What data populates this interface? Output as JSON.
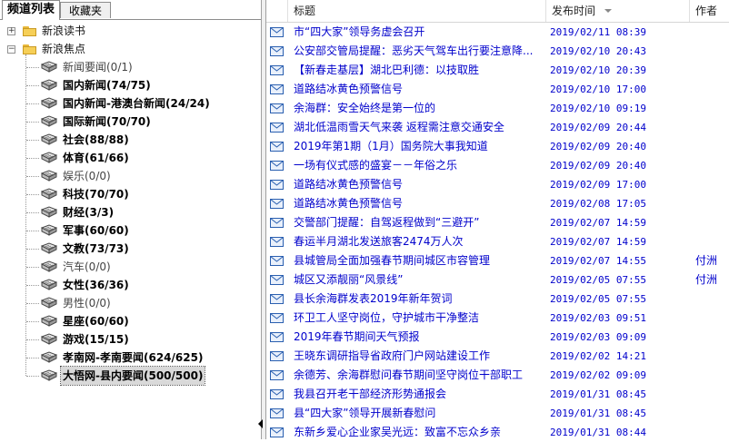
{
  "left_panel": {
    "tabs": [
      {
        "label": "频道列表",
        "active": true
      },
      {
        "label": "收藏夹",
        "active": false
      }
    ],
    "tree": [
      {
        "label": "新浪读书",
        "level": 0,
        "type": "folder",
        "expander": "+"
      },
      {
        "label": "新浪焦点",
        "level": 0,
        "type": "folder",
        "expander": "−"
      },
      {
        "label": "新闻要闻(0/1)",
        "level": 1,
        "type": "channel",
        "bold": false
      },
      {
        "label": "国内新闻(74/75)",
        "level": 1,
        "type": "channel",
        "bold": true
      },
      {
        "label": "国内新闻-港澳台新闻(24/24)",
        "level": 1,
        "type": "channel",
        "bold": true
      },
      {
        "label": "国际新闻(70/70)",
        "level": 1,
        "type": "channel",
        "bold": true
      },
      {
        "label": "社会(88/88)",
        "level": 1,
        "type": "channel",
        "bold": true
      },
      {
        "label": "体育(61/66)",
        "level": 1,
        "type": "channel",
        "bold": true
      },
      {
        "label": "娱乐(0/0)",
        "level": 1,
        "type": "channel",
        "bold": false
      },
      {
        "label": "科技(70/70)",
        "level": 1,
        "type": "channel",
        "bold": true
      },
      {
        "label": "财经(3/3)",
        "level": 1,
        "type": "channel",
        "bold": true
      },
      {
        "label": "军事(60/60)",
        "level": 1,
        "type": "channel",
        "bold": true
      },
      {
        "label": "文教(73/73)",
        "level": 1,
        "type": "channel",
        "bold": true
      },
      {
        "label": "汽车(0/0)",
        "level": 1,
        "type": "channel",
        "bold": false
      },
      {
        "label": "女性(36/36)",
        "level": 1,
        "type": "channel",
        "bold": true
      },
      {
        "label": "男性(0/0)",
        "level": 1,
        "type": "channel",
        "bold": false
      },
      {
        "label": "星座(60/60)",
        "level": 1,
        "type": "channel",
        "bold": true
      },
      {
        "label": "游戏(15/15)",
        "level": 1,
        "type": "channel",
        "bold": true
      },
      {
        "label": "孝南网-孝南要闻(624/625)",
        "level": 1,
        "type": "channel",
        "bold": true
      },
      {
        "label": "大悟网-县内要闻(500/500)",
        "level": 1,
        "type": "channel",
        "bold": true,
        "selected": true
      }
    ]
  },
  "right_panel": {
    "columns": {
      "title": "标题",
      "date": "发布时间",
      "author": "作者"
    },
    "rows": [
      {
        "title": "市“四大家”领导务虚会召开",
        "date": "2019/02/11 08:39",
        "author": ""
      },
      {
        "title": "公安部交管局提醒：恶劣天气驾车出行要注意降...",
        "date": "2019/02/10 20:43",
        "author": ""
      },
      {
        "title": "【新春走基层】湖北巴利德：以技取胜",
        "date": "2019/02/10 20:39",
        "author": ""
      },
      {
        "title": "道路结冰黄色预警信号",
        "date": "2019/02/10 17:00",
        "author": ""
      },
      {
        "title": "余海群：安全始终是第一位的",
        "date": "2019/02/10 09:19",
        "author": ""
      },
      {
        "title": "湖北低温雨雪天气来袭 返程需注意交通安全",
        "date": "2019/02/09 20:44",
        "author": ""
      },
      {
        "title": "2019年第1期（1月）国务院大事我知道",
        "date": "2019/02/09 20:40",
        "author": ""
      },
      {
        "title": "一场有仪式感的盛宴－－年俗之乐",
        "date": "2019/02/09 20:40",
        "author": ""
      },
      {
        "title": "道路结冰黄色预警信号",
        "date": "2019/02/09 17:00",
        "author": ""
      },
      {
        "title": "道路结冰黄色预警信号",
        "date": "2019/02/08 17:05",
        "author": ""
      },
      {
        "title": "交警部门提醒：自驾返程做到“三避开”",
        "date": "2019/02/07 14:59",
        "author": ""
      },
      {
        "title": "春运半月湖北发送旅客2474万人次",
        "date": "2019/02/07 14:59",
        "author": ""
      },
      {
        "title": "县城管局全面加强春节期间城区市容管理",
        "date": "2019/02/07 14:55",
        "author": "付洲"
      },
      {
        "title": "城区又添靓丽“风景线”",
        "date": "2019/02/05 07:55",
        "author": "付洲"
      },
      {
        "title": "县长余海群发表2019年新年贺词",
        "date": "2019/02/05 07:55",
        "author": ""
      },
      {
        "title": "环卫工人坚守岗位，守护城市干净整洁",
        "date": "2019/02/03 09:51",
        "author": ""
      },
      {
        "title": "2019年春节期间天气预报",
        "date": "2019/02/03 09:09",
        "author": ""
      },
      {
        "title": "王晓东调研指导省政府门户网站建设工作",
        "date": "2019/02/02 14:21",
        "author": ""
      },
      {
        "title": "余德芳、余海群慰问春节期间坚守岗位干部职工",
        "date": "2019/02/02 09:09",
        "author": ""
      },
      {
        "title": "我县召开老干部经济形势通报会",
        "date": "2019/01/31 08:45",
        "author": ""
      },
      {
        "title": "县“四大家”领导开展新春慰问",
        "date": "2019/01/31 08:45",
        "author": ""
      },
      {
        "title": "东新乡爱心企业家吴光远：致富不忘众乡亲",
        "date": "2019/01/31 08:44",
        "author": ""
      }
    ]
  },
  "colors": {
    "link": "#0000cc",
    "selected_bg": "#d9d9d9",
    "folder": "#f6cf57"
  },
  "icons": {
    "folder": "folder-icon",
    "channel": "book-icon",
    "row": "envelope-icon"
  }
}
